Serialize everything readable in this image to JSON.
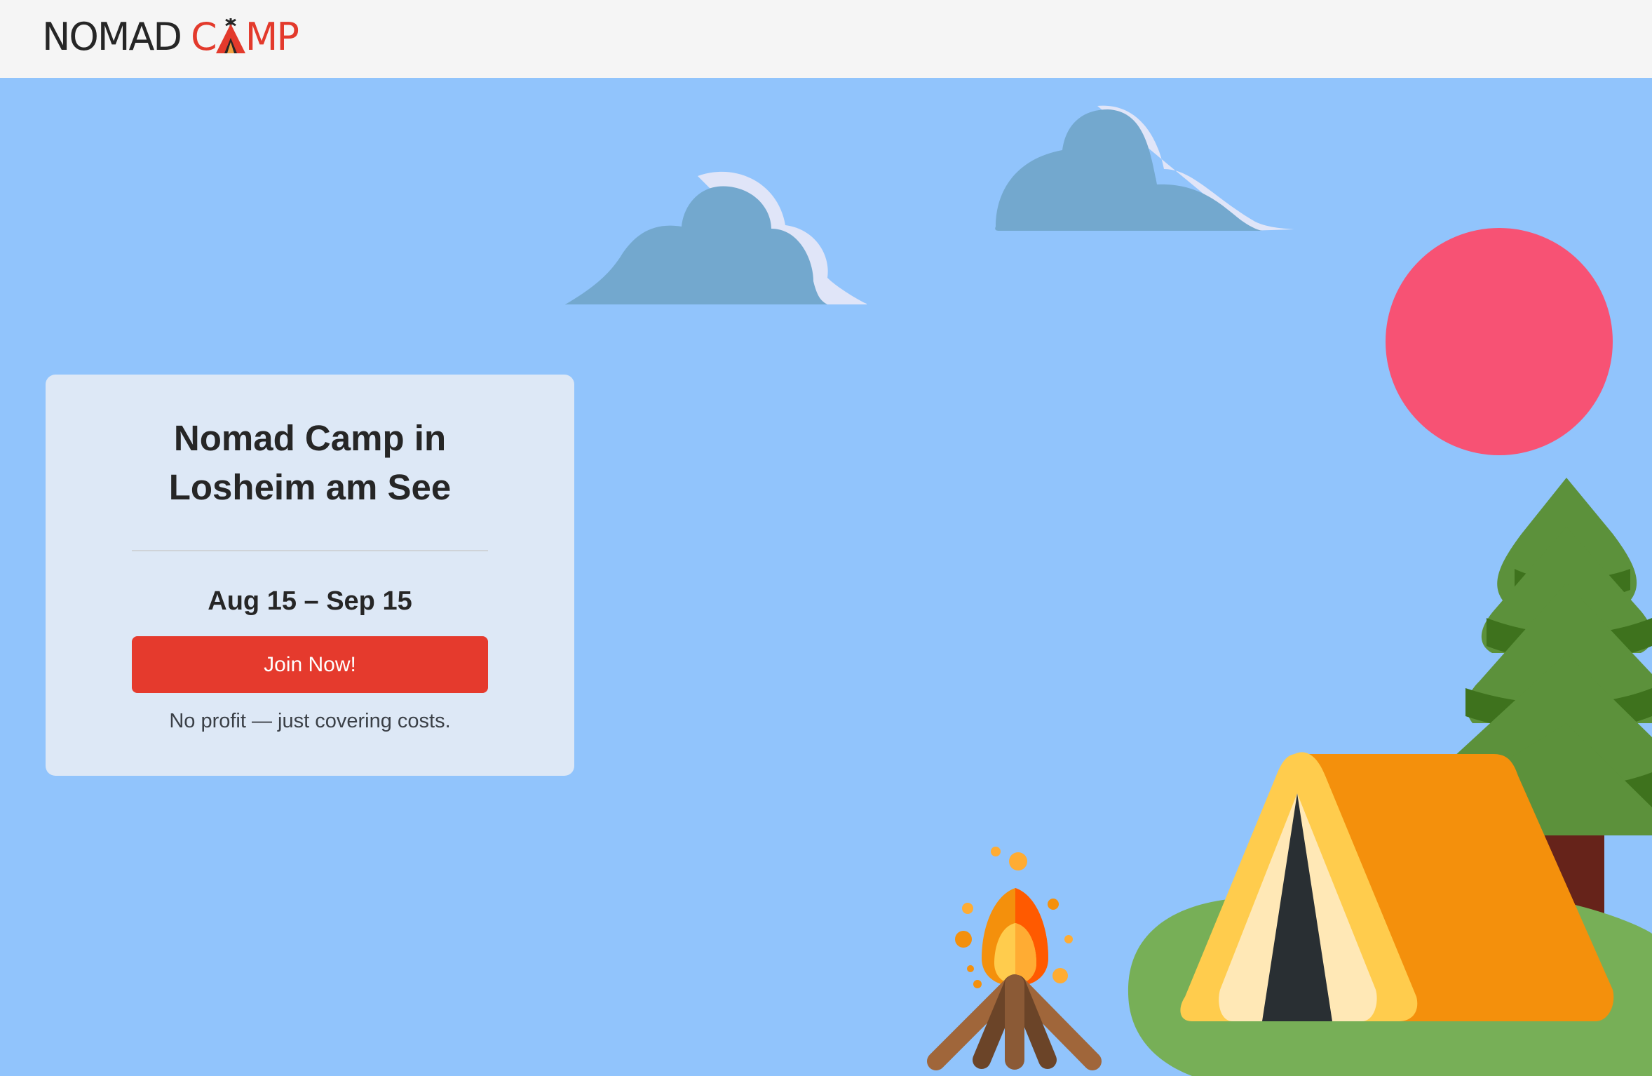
{
  "header": {
    "logo_part1": "NOMAD",
    "logo_part2_before": "C",
    "logo_part2_after": "MP"
  },
  "card": {
    "title_line1": "Nomad Camp in",
    "title_line2": "Losheim am See",
    "dates": "Aug 15 – Sep 15",
    "join_label": "Join Now!",
    "note": "No profit — just covering costs."
  },
  "colors": {
    "sky": "#91c4fc",
    "header_bg": "#f5f5f5",
    "accent_red": "#e53a2d",
    "card_bg": "#dde8f6",
    "sun": "#f75274"
  }
}
